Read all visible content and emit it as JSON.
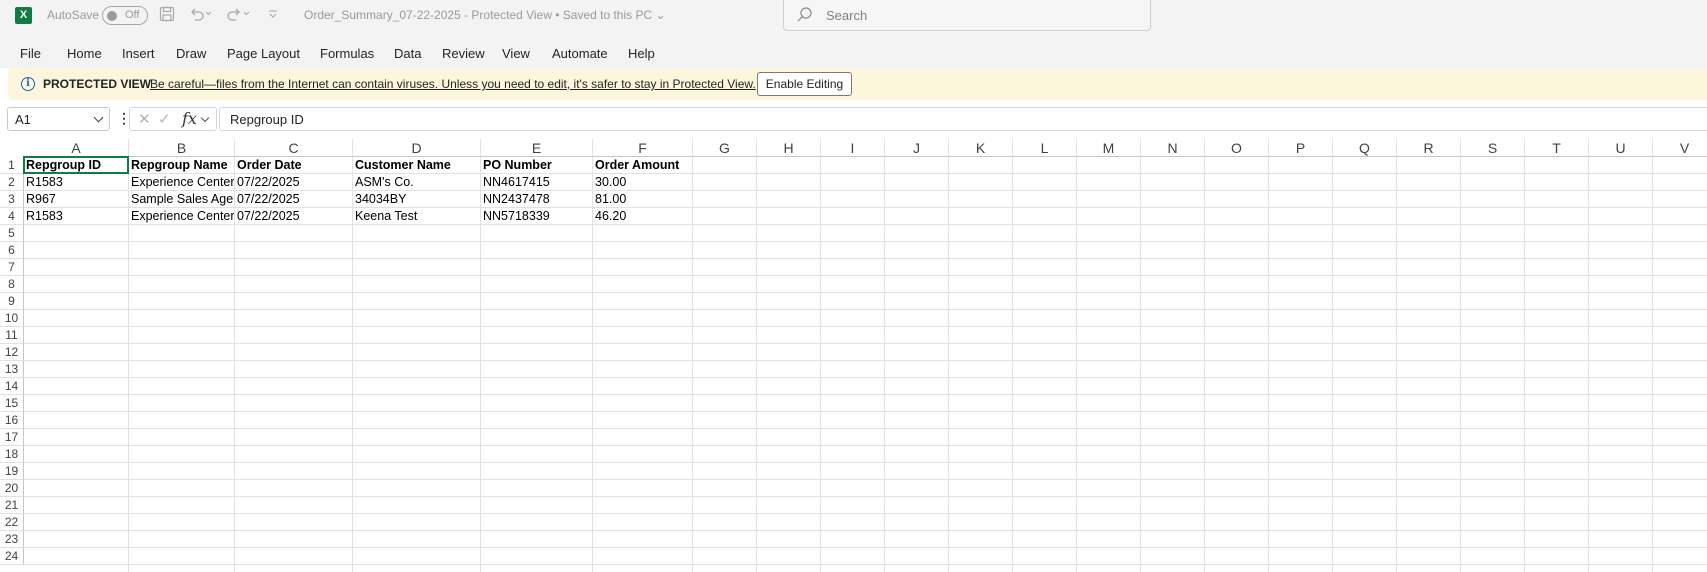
{
  "titlebar": {
    "autosave_label": "AutoSave",
    "autosave_state": "Off",
    "file_title": "Order_Summary_07-22-2025  -  Protected View • Saved to this PC ⌄",
    "search_placeholder": "Search"
  },
  "menu": [
    "File",
    "Home",
    "Insert",
    "Draw",
    "Page Layout",
    "Formulas",
    "Data",
    "Review",
    "View",
    "Automate",
    "Help"
  ],
  "protected_view": {
    "title": "PROTECTED VIEW",
    "message": "Be careful—files from the Internet can contain viruses. Unless you need to edit, it's safer to stay in Protected View.",
    "button": "Enable Editing"
  },
  "formula_bar": {
    "name_box": "A1",
    "fx": "fx",
    "content": "Repgroup ID"
  },
  "sheet": {
    "columns": [
      "A",
      "B",
      "C",
      "D",
      "E",
      "F",
      "G",
      "H",
      "I",
      "J",
      "K",
      "L",
      "M",
      "N",
      "O",
      "P",
      "Q",
      "R",
      "S",
      "T",
      "U",
      "V"
    ],
    "rows": [
      "1",
      "2",
      "3",
      "4",
      "5",
      "6",
      "7",
      "8",
      "9",
      "10",
      "11",
      "12",
      "13",
      "14",
      "15",
      "16",
      "17",
      "18",
      "19",
      "20",
      "21",
      "22",
      "23",
      "24"
    ],
    "header": [
      "Repgroup ID",
      "Repgroup Name",
      "Order Date",
      "Customer Name",
      "PO Number",
      "Order Amount"
    ],
    "data": [
      [
        "R1583",
        "Experience Center",
        "07/22/2025",
        "ASM's Co.",
        "NN4617415",
        "30.00"
      ],
      [
        "R967",
        "Sample Sales Agency",
        "07/22/2025",
        "34034BY",
        "NN2437478",
        "81.00"
      ],
      [
        "R1583",
        "Experience Center",
        "07/22/2025",
        "Keena Test",
        "NN5718339",
        "46.20"
      ]
    ]
  }
}
